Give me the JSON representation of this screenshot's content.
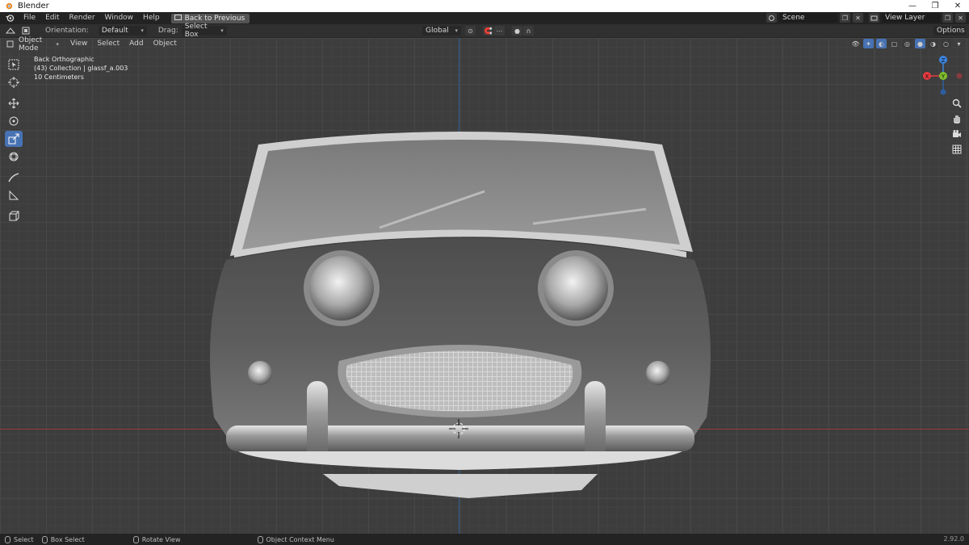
{
  "window": {
    "title": "Blender",
    "minimize": "—",
    "maximize": "❐",
    "close": "✕"
  },
  "topbar": {
    "menus": [
      "File",
      "Edit",
      "Render",
      "Window",
      "Help"
    ],
    "back_button": "Back to Previous",
    "scene": "Scene",
    "view_layer": "View Layer"
  },
  "toolheader": {
    "orientation_label": "Orientation:",
    "orientation_value": "Default",
    "drag_label": "Drag:",
    "drag_value": "Select Box",
    "transform_orientation": "Global",
    "options": "Options"
  },
  "viewport_header": {
    "mode": "Object Mode",
    "menus": [
      "View",
      "Select",
      "Add",
      "Object"
    ]
  },
  "viewport": {
    "view_name": "Back Orthographic",
    "collection": "(43) Collection | glassf_a.003",
    "scale": "10 Centimeters"
  },
  "gizmo": {
    "z": "Z",
    "x": "X",
    "y": "Y"
  },
  "statusbar": {
    "select": "Select",
    "box_select": "Box Select",
    "rotate_view": "Rotate View",
    "context_menu": "Object Context Menu",
    "version": "2.92.0"
  },
  "colors": {
    "accent": "#4772b3",
    "x_axis": "#9a3a3a",
    "z_axis": "#2f5f95",
    "gizmo_x": "#e8393f",
    "gizmo_y": "#7fbe2c",
    "gizmo_z": "#3b84e0"
  }
}
